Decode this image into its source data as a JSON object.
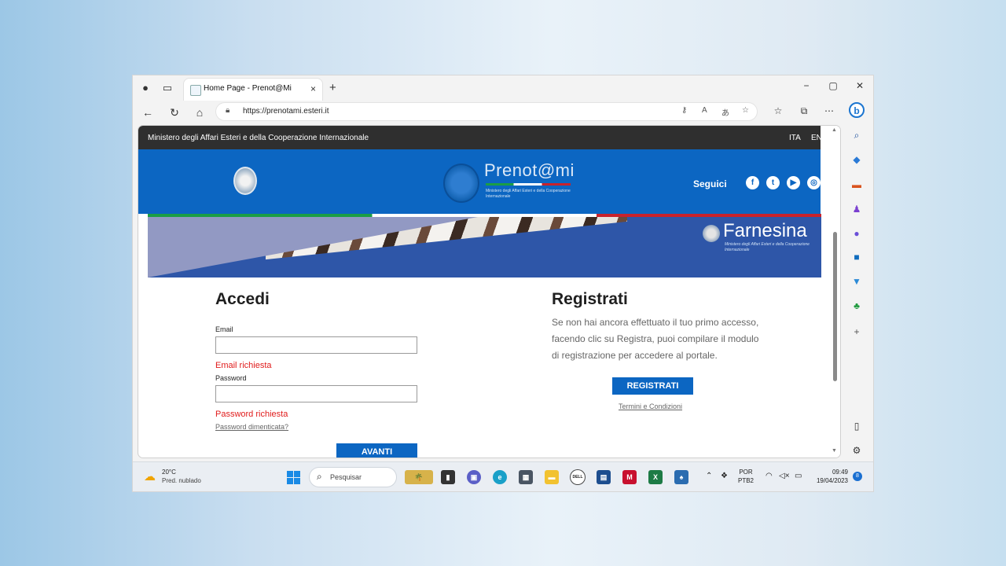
{
  "browser": {
    "tab_title": "Home Page - Prenot@Mi",
    "tab_close": "×",
    "new_tab": "+",
    "url": "https://prenotami.esteri.it",
    "window_controls": {
      "minimize": "−",
      "maximize": "▢",
      "close": "✕"
    }
  },
  "page": {
    "ministry": "Ministero degli Affari Esteri e della Cooperazione Internazionale",
    "lang_ita": "ITA",
    "lang_en": "EN",
    "brand": "Prenot@mi",
    "brand_sub": "Ministero degli Affari Esteri e della Cooperazione Internazionale",
    "seguici": "Seguici",
    "farnesina": "Farnesina",
    "farnesina_sub": "Ministero degli Affari Esteri e della Cooperazione Internazionale",
    "login": {
      "title": "Accedi",
      "email_label": "Email",
      "email_error": "Email richiesta",
      "password_label": "Password",
      "password_error": "Password richiesta",
      "forgot": "Password dimenticata?",
      "submit": "AVANTI"
    },
    "register": {
      "title": "Registrati",
      "text": "Se non hai ancora effettuato il tuo primo accesso, facendo clic su Registra, puoi compilare il modulo di registrazione per accedere al portale.",
      "button": "REGISTRATI",
      "terms": "Termini e Condizioni"
    }
  },
  "taskbar": {
    "temp": "20°C",
    "weather": "Pred. nublado",
    "search": "Pesquisar",
    "lang_top": "POR",
    "lang_bottom": "PTB2",
    "time": "09:49",
    "date": "19/04/2023",
    "notifications": "8"
  }
}
